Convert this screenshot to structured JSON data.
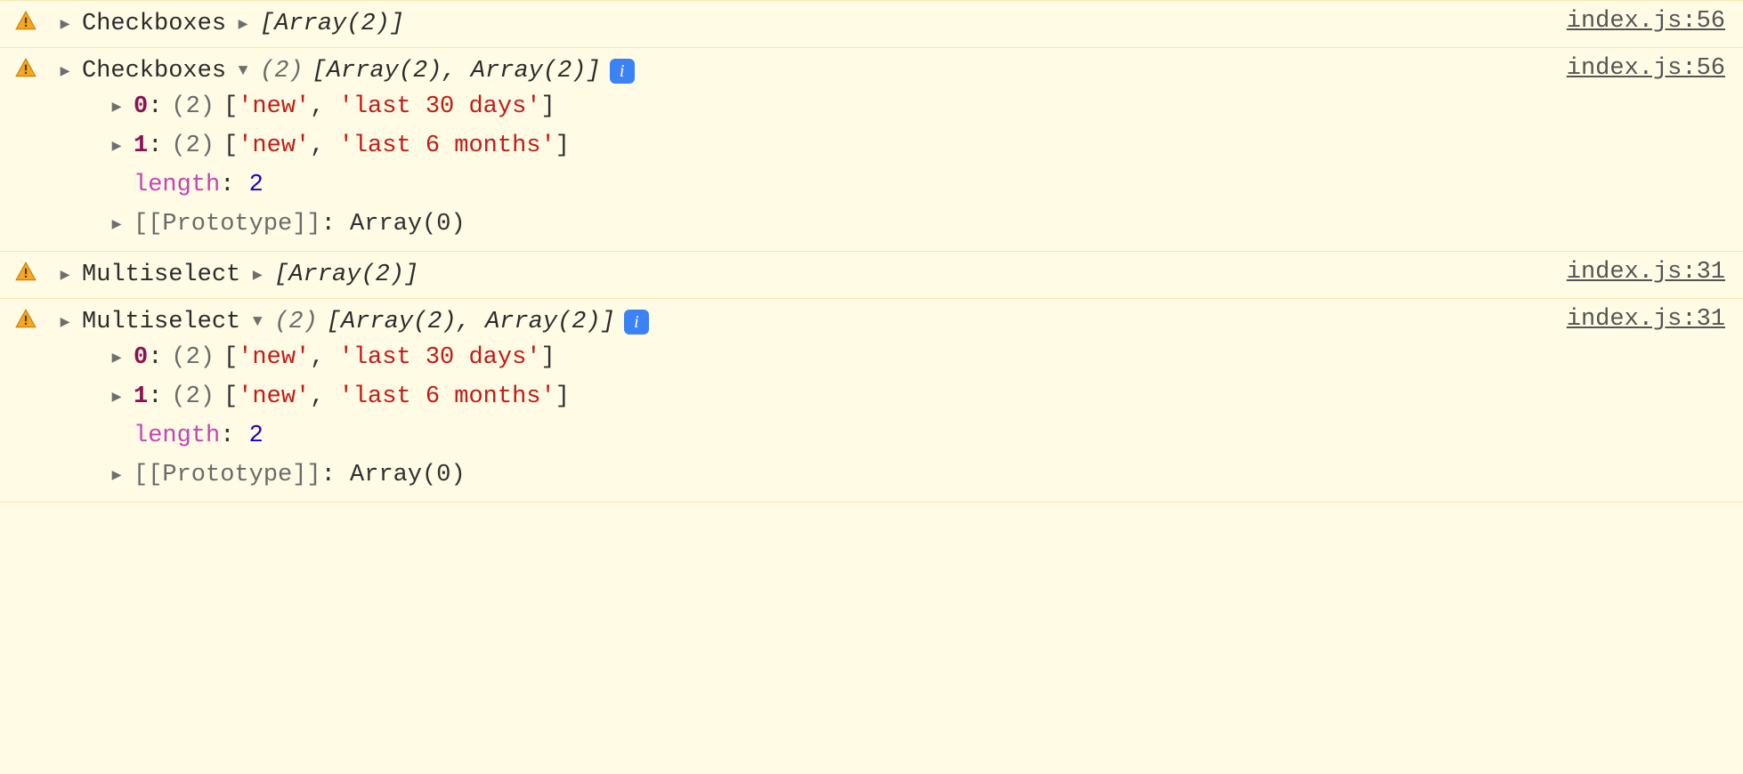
{
  "rows": [
    {
      "label": "Checkboxes",
      "collapsedPreview": "[Array(2)]",
      "source": "index.js:56",
      "expanded": false
    },
    {
      "label": "Checkboxes",
      "headerCount": "(2)",
      "headerPreview": "[Array(2), Array(2)]",
      "source": "index.js:56",
      "expanded": true,
      "items": [
        {
          "index": "0",
          "count": "(2)",
          "v0": "'new'",
          "v1": "'last 30 days'"
        },
        {
          "index": "1",
          "count": "(2)",
          "v0": "'new'",
          "v1": "'last 6 months'"
        }
      ],
      "lengthLabel": "length",
      "lengthValue": "2",
      "protoLabel": "[[Prototype]]",
      "protoValue": "Array(0)"
    },
    {
      "label": "Multiselect",
      "collapsedPreview": "[Array(2)]",
      "source": "index.js:31",
      "expanded": false
    },
    {
      "label": "Multiselect",
      "headerCount": "(2)",
      "headerPreview": "[Array(2), Array(2)]",
      "source": "index.js:31",
      "expanded": true,
      "items": [
        {
          "index": "0",
          "count": "(2)",
          "v0": "'new'",
          "v1": "'last 30 days'"
        },
        {
          "index": "1",
          "count": "(2)",
          "v0": "'new'",
          "v1": "'last 6 months'"
        }
      ],
      "lengthLabel": "length",
      "lengthValue": "2",
      "protoLabel": "[[Prototype]]",
      "protoValue": "Array(0)"
    }
  ],
  "infoGlyph": "i"
}
